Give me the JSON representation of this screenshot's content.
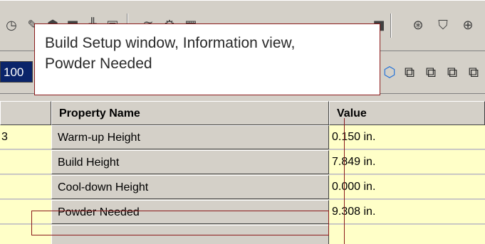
{
  "callout": {
    "line1": "Build Setup window, Information view,",
    "line2": "Powder Needed"
  },
  "toolbar": {
    "zoom_value": "100",
    "icons_row1": [
      "clock-icon",
      "wand-icon",
      "package-icon",
      "box-icon",
      "tools-icon",
      "palette-icon",
      "layers-icon",
      "settings-icon",
      "grid-icon",
      "scan-icon",
      "disc-icon",
      "shield-icon",
      "globe-icon"
    ],
    "icons_row2": [
      "cube-icon",
      "cube-wire-icon",
      "cube-front-icon",
      "cube-side-icon"
    ]
  },
  "grid": {
    "headers": {
      "first": "",
      "property": "Property Name",
      "value": "Value"
    },
    "rows": [
      {
        "left": "3",
        "property": "Warm-up Height",
        "value": "0.150 in."
      },
      {
        "left": "",
        "property": "Build Height",
        "value": "7.849 in."
      },
      {
        "left": "",
        "property": "Cool-down Height",
        "value": "0.000 in."
      },
      {
        "left": "",
        "property": "Powder Needed",
        "value": "9.308 in."
      }
    ]
  },
  "colors": {
    "row_bg": "#ffffc8",
    "chrome": "#d4d0c8",
    "callout_border": "#8b1a1a"
  }
}
